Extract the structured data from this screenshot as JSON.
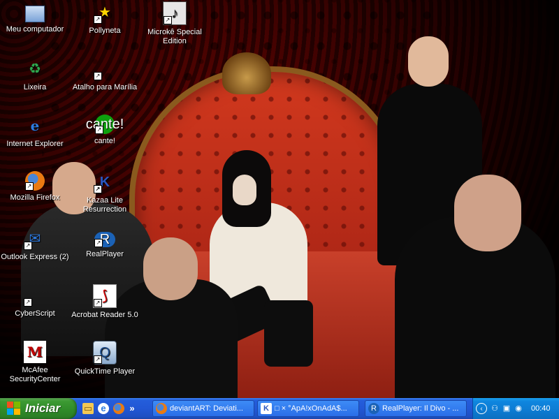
{
  "desktop": {
    "icons": [
      {
        "label": "Meu computador",
        "icon": "my-computer-icon"
      },
      {
        "label": "Pollyneta",
        "icon": "star-icon",
        "shortcut": true
      },
      {
        "label": "Microkê Special Edition",
        "icon": "microke-icon",
        "shortcut": true
      },
      {
        "label": "Lixeira",
        "icon": "recycle-bin-icon"
      },
      {
        "label": "Atalho para Marília",
        "icon": "shortcut-icon",
        "shortcut": true
      },
      {
        "label": "Internet Explorer",
        "icon": "internet-explorer-icon"
      },
      {
        "label": "cante!",
        "icon": "cante-icon",
        "icon_text": "cante!",
        "shortcut": true
      },
      {
        "label": "Mozilla Firefox",
        "icon": "firefox-icon",
        "shortcut": true
      },
      {
        "label": "Kazaa Lite Resurrection",
        "icon": "kazaa-icon",
        "shortcut": true
      },
      {
        "label": "Outlook Express (2)",
        "icon": "outlook-express-icon",
        "shortcut": true
      },
      {
        "label": "RealPlayer",
        "icon": "realplayer-icon",
        "shortcut": true
      },
      {
        "label": "CyberScript",
        "icon": "cyberscript-icon",
        "shortcut": true
      },
      {
        "label": "Acrobat Reader 5.0",
        "icon": "acrobat-reader-icon",
        "shortcut": true
      },
      {
        "label": "McAfee SecurityCenter",
        "icon": "mcafee-icon",
        "icon_text": "M"
      },
      {
        "label": "QuickTime Player",
        "icon": "quicktime-icon",
        "shortcut": true
      }
    ]
  },
  "taskbar": {
    "start_label": "Iniciar",
    "quick_launch": [
      {
        "icon": "folder-icon"
      },
      {
        "icon": "internet-explorer-icon"
      },
      {
        "icon": "firefox-icon"
      }
    ],
    "quick_more": "»",
    "tasks": [
      {
        "label": "deviantART: Deviati...",
        "icon": "firefox-icon"
      },
      {
        "label": "□ × °ApA!xOnAdA$...",
        "icon": "kazaa-icon"
      },
      {
        "label": "RealPlayer: Il Divo - ...",
        "icon": "realplayer-icon"
      }
    ],
    "tray": {
      "chevron": "‹",
      "icons": [
        "network-icon",
        "display-icon",
        "volume-icon"
      ],
      "clock": "00:40"
    }
  },
  "colors": {
    "taskbar_blue": "#245edb",
    "start_green": "#3c9a33",
    "tray_blue": "#0f86df"
  }
}
